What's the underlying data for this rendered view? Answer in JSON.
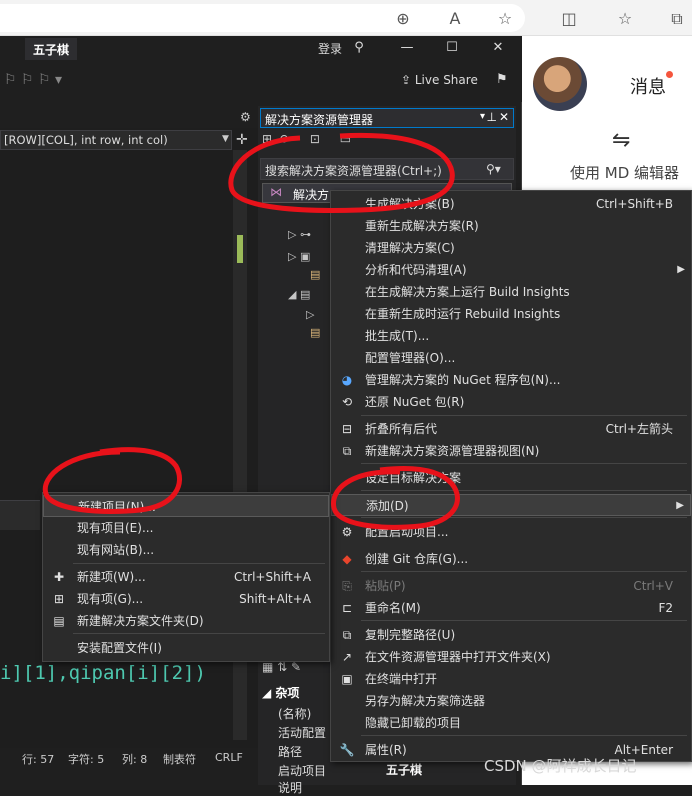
{
  "vs": {
    "project_name": "五子棋",
    "login": "登录",
    "live_share": "Live Share",
    "func_signature": "[ROW][COL], int row, int col)",
    "code_fragment": "i][1],qipan[i][2])",
    "status": {
      "line": "行: 57",
      "char": "字符: 5",
      "col": "列: 8",
      "tabs": "制表符",
      "eol": "CRLF"
    }
  },
  "solution_explorer": {
    "title": "解决方案资源管理器",
    "search_placeholder": "搜索解决方案资源管理器(Ctrl+;)",
    "selected_item": "解决方"
  },
  "properties": {
    "section": "杂项",
    "rows": [
      "(名称)",
      "活动配置",
      "路径",
      "启动项目",
      "说明"
    ],
    "startup_value": "五子棋"
  },
  "web": {
    "messages": "消息",
    "md_editor": "使用 MD 编辑器",
    "watermark": "CSDN @阿祥成长日记"
  },
  "main_menu": [
    {
      "label": "生成解决方案(B)",
      "shortcut": "Ctrl+Shift+B",
      "icon": ""
    },
    {
      "label": "重新生成解决方案(R)",
      "shortcut": "",
      "icon": ""
    },
    {
      "label": "清理解决方案(C)",
      "shortcut": "",
      "icon": ""
    },
    {
      "label": "分析和代码清理(A)",
      "shortcut": "",
      "icon": "",
      "submenu": true
    },
    {
      "label": "在生成解决方案上运行 Build Insights",
      "shortcut": "",
      "icon": ""
    },
    {
      "label": "在重新生成时运行 Rebuild Insights",
      "shortcut": "",
      "icon": ""
    },
    {
      "label": "批生成(T)...",
      "shortcut": "",
      "icon": ""
    },
    {
      "label": "配置管理器(O)...",
      "shortcut": "",
      "icon": ""
    },
    {
      "label": "管理解决方案的 NuGet 程序包(N)...",
      "shortcut": "",
      "icon": "nuget-icon"
    },
    {
      "label": "还原 NuGet 包(R)",
      "shortcut": "",
      "icon": "restore-icon"
    },
    {
      "label": "折叠所有后代",
      "shortcut": "Ctrl+左箭头",
      "icon": "collapse-icon"
    },
    {
      "label": "新建解决方案资源管理器视图(N)",
      "shortcut": "",
      "icon": "new-view-icon"
    },
    {
      "label": "设定目标解决方案",
      "shortcut": "",
      "icon": ""
    },
    {
      "label": "添加(D)",
      "shortcut": "",
      "icon": "",
      "submenu": true,
      "highlight": true
    },
    {
      "label": "配置启动项目...",
      "shortcut": "",
      "icon": "gear-icon"
    },
    {
      "label": "创建 Git 仓库(G)...",
      "shortcut": "",
      "icon": "git-icon"
    },
    {
      "label": "粘贴(P)",
      "shortcut": "Ctrl+V",
      "icon": "paste-icon",
      "disabled": true
    },
    {
      "label": "重命名(M)",
      "shortcut": "F2",
      "icon": "rename-icon"
    },
    {
      "label": "复制完整路径(U)",
      "shortcut": "",
      "icon": "copy-icon"
    },
    {
      "label": "在文件资源管理器中打开文件夹(X)",
      "shortcut": "",
      "icon": "open-folder-icon"
    },
    {
      "label": "在终端中打开",
      "shortcut": "",
      "icon": "terminal-icon"
    },
    {
      "label": "另存为解决方案筛选器",
      "shortcut": "",
      "icon": ""
    },
    {
      "label": "隐藏已卸载的项目",
      "shortcut": "",
      "icon": ""
    },
    {
      "label": "属性(R)",
      "shortcut": "Alt+Enter",
      "icon": "wrench-icon"
    }
  ],
  "add_submenu": [
    {
      "label": "新建项目(N)...",
      "shortcut": "",
      "icon": "",
      "highlight": true
    },
    {
      "label": "现有项目(E)...",
      "shortcut": "",
      "icon": ""
    },
    {
      "label": "现有网站(B)...",
      "shortcut": "",
      "icon": ""
    },
    {
      "label": "新建项(W)...",
      "shortcut": "Ctrl+Shift+A",
      "icon": "new-item-icon"
    },
    {
      "label": "现有项(G)...",
      "shortcut": "Shift+Alt+A",
      "icon": "existing-item-icon"
    },
    {
      "label": "新建解决方案文件夹(D)",
      "shortcut": "",
      "icon": "folder-icon"
    },
    {
      "label": "安装配置文件(I)",
      "shortcut": "",
      "icon": ""
    }
  ]
}
